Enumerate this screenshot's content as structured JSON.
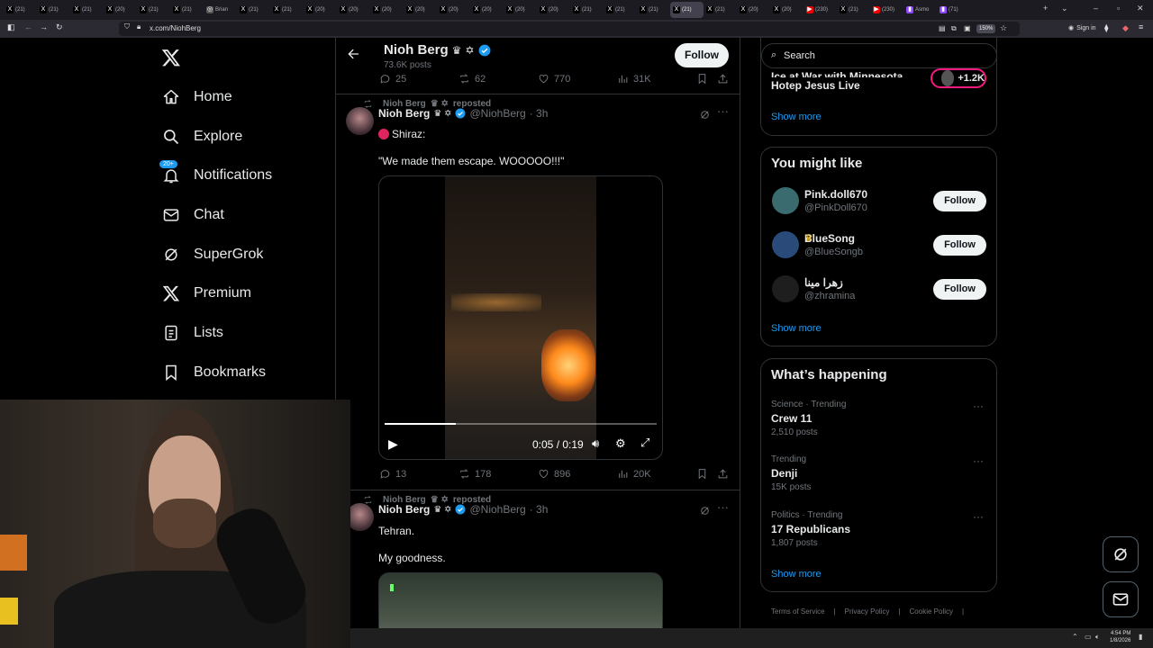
{
  "browser": {
    "tabs": [
      {
        "label": "(21)",
        "icon": "x-icon"
      },
      {
        "label": "(21)",
        "icon": "x-icon"
      },
      {
        "label": "(21)",
        "icon": "x-icon"
      },
      {
        "label": "(20)",
        "icon": "x-icon"
      },
      {
        "label": "(21)",
        "icon": "x-icon"
      },
      {
        "label": "(21)",
        "icon": "x-icon"
      },
      {
        "label": "Brian",
        "icon": "globe-icon"
      },
      {
        "label": "(21)",
        "icon": "x-icon"
      },
      {
        "label": "(21)",
        "icon": "x-icon"
      },
      {
        "label": "(20)",
        "icon": "x-icon"
      },
      {
        "label": "(20)",
        "icon": "x-icon"
      },
      {
        "label": "(20)",
        "icon": "x-icon"
      },
      {
        "label": "(20)",
        "icon": "x-icon"
      },
      {
        "label": "(20)",
        "icon": "x-icon"
      },
      {
        "label": "(20)",
        "icon": "x-icon"
      },
      {
        "label": "(20)",
        "icon": "x-icon"
      },
      {
        "label": "(20)",
        "icon": "x-icon"
      },
      {
        "label": "(21)",
        "icon": "x-icon"
      },
      {
        "label": "(21)",
        "icon": "x-icon"
      },
      {
        "label": "(21)",
        "icon": "x-icon"
      },
      {
        "label": "(21)",
        "icon": "x-icon",
        "active": true
      },
      {
        "label": "(21)",
        "icon": "x-icon"
      },
      {
        "label": "(20)",
        "icon": "x-icon"
      },
      {
        "label": "(20)",
        "icon": "x-icon"
      },
      {
        "label": "(230)",
        "icon": "youtube-icon"
      },
      {
        "label": "(21)",
        "icon": "x-icon"
      },
      {
        "label": "(230)",
        "icon": "youtube-icon"
      },
      {
        "label": "Asmo",
        "icon": "twitch-icon"
      },
      {
        "label": "(71)",
        "icon": "twitch-icon"
      }
    ],
    "url": "x.com/NiohBerg",
    "zoom": "150%",
    "sign_in": "Sign in"
  },
  "nav": {
    "items": [
      {
        "label": "Home",
        "icon": "home-icon"
      },
      {
        "label": "Explore",
        "icon": "search-icon"
      },
      {
        "label": "Notifications",
        "icon": "bell-icon",
        "badge": "20+"
      },
      {
        "label": "Chat",
        "icon": "mail-icon"
      },
      {
        "label": "SuperGrok",
        "icon": "grok-icon"
      },
      {
        "label": "Premium",
        "icon": "x-logo-icon"
      },
      {
        "label": "Lists",
        "icon": "list-icon"
      },
      {
        "label": "Bookmarks",
        "icon": "bookmark-icon"
      }
    ]
  },
  "profile_header": {
    "name": "Nioh Berg",
    "posts_count": "73.6K posts",
    "follow_label": "Follow"
  },
  "prev_post_actions": {
    "replies": "25",
    "reposts": "62",
    "likes": "770",
    "views": "31K"
  },
  "post1": {
    "repost_label": "Nioh Berg",
    "repost_suffix": "reposted",
    "author_name": "Nioh Berg",
    "handle": "@NiohBerg",
    "time": "· 3h",
    "text_line1": "Shiraz:",
    "text_line2": "\"We made them escape. WOOOOO!!!\"",
    "video_time": "0:05 / 0:19",
    "video_progress": 0.26,
    "actions": {
      "replies": "13",
      "reposts": "178",
      "likes": "896",
      "views": "20K"
    }
  },
  "post2": {
    "repost_label": "Nioh Berg",
    "repost_suffix": "reposted",
    "author_name": "Nioh Berg",
    "handle": "@NiohBerg",
    "time": "· 3h",
    "text_line1": "Tehran.",
    "text_line2": "My goodness."
  },
  "sidebar": {
    "search_placeholder": "Search",
    "prev_trend_line1": "Ice at War with Minnesota",
    "prev_trend_line2": "Hotep Jesus Live",
    "live_count": "+1.2K",
    "show_more_1": "Show more",
    "you_might_like": {
      "title": "You might like",
      "users": [
        {
          "name": "Pink.doll670",
          "handle": "@PinkDoll670",
          "follow": "Follow",
          "avatar_color": "#3a6b6e"
        },
        {
          "name": "BlueSong",
          "handle": "@BlueSongb",
          "follow": "Follow",
          "avatar_color": "#2a4a7a"
        },
        {
          "name": "زهرا مینا",
          "handle": "@zhramina",
          "follow": "Follow",
          "avatar_color": "#1e1e1e"
        }
      ],
      "show_more": "Show more"
    },
    "whats_happening": {
      "title": "What’s happening",
      "trends": [
        {
          "context": "Science · Trending",
          "name": "Crew 11",
          "posts": "2,510 posts"
        },
        {
          "context": "Trending",
          "name": "Denji",
          "posts": "15K posts"
        },
        {
          "context": "Politics · Trending",
          "name": "17 Republicans",
          "posts": "1,807 posts"
        }
      ],
      "show_more": "Show more"
    },
    "footer": [
      "Terms of Service",
      "Privacy Policy",
      "Cookie Policy"
    ]
  },
  "taskbar": {
    "time": "4:54 PM",
    "date": "1/8/2026"
  },
  "colors": {
    "accent": "#1d9bf0",
    "bg": "#000000",
    "border": "#2f3336",
    "muted": "#71767b",
    "live_ring": "#f91880"
  }
}
